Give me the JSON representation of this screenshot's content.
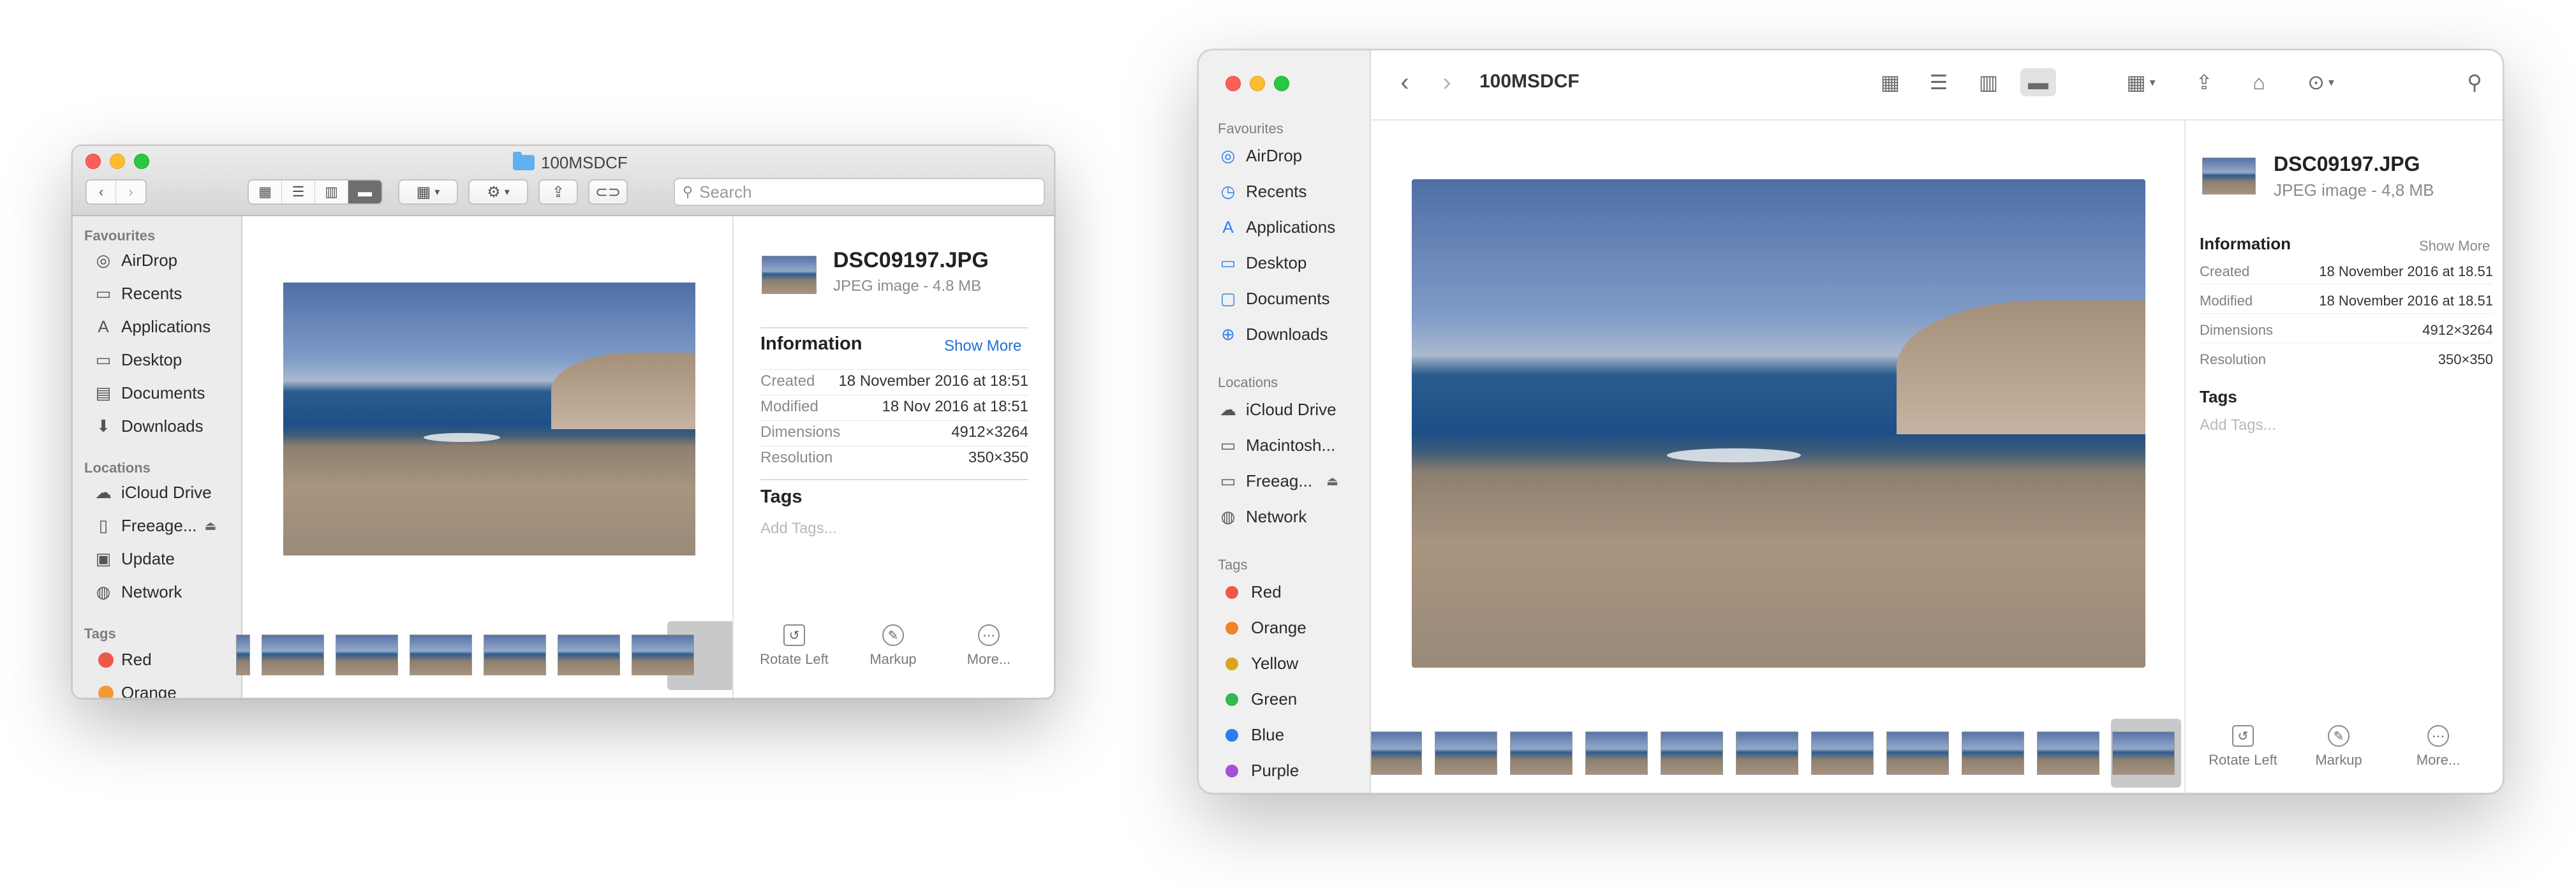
{
  "left_window": {
    "title": "100MSDCF",
    "search_placeholder": "Search",
    "sidebar": {
      "favourites_header": "Favourites",
      "favourites": [
        {
          "label": "AirDrop",
          "icon": "airdrop-icon"
        },
        {
          "label": "Recents",
          "icon": "clock-icon"
        },
        {
          "label": "Applications",
          "icon": "applications-icon"
        },
        {
          "label": "Desktop",
          "icon": "desktop-icon"
        },
        {
          "label": "Documents",
          "icon": "document-icon"
        },
        {
          "label": "Downloads",
          "icon": "download-icon"
        }
      ],
      "locations_header": "Locations",
      "locations": [
        {
          "label": "iCloud Drive",
          "icon": "cloud-icon"
        },
        {
          "label": "Freeage...",
          "icon": "drive-icon",
          "eject": "⏏"
        },
        {
          "label": "Update",
          "icon": "disk-icon"
        },
        {
          "label": "Network",
          "icon": "globe-icon"
        }
      ],
      "tags_header": "Tags",
      "tags": [
        {
          "label": "Red",
          "color": "#f0564a"
        },
        {
          "label": "Orange",
          "color": "#f39a38"
        }
      ]
    },
    "info": {
      "filename": "DSC09197.JPG",
      "filetype": "JPEG image - 4.8 MB",
      "information_header": "Information",
      "show_more": "Show More",
      "rows": [
        {
          "key": "Created",
          "value": "18 November 2016 at 18:51"
        },
        {
          "key": "Modified",
          "value": "18 Nov 2016 at 18:51"
        },
        {
          "key": "Dimensions",
          "value": "4912×3264"
        },
        {
          "key": "Resolution",
          "value": "350×350"
        }
      ],
      "tags_header": "Tags",
      "add_tags": "Add Tags...",
      "actions": [
        {
          "label": "Rotate Left",
          "icon": "rotate-left-icon"
        },
        {
          "label": "Markup",
          "icon": "markup-icon"
        },
        {
          "label": "More...",
          "icon": "more-icon"
        }
      ]
    }
  },
  "right_window": {
    "title": "100MSDCF",
    "sidebar": {
      "favourites_header": "Favourites",
      "favourites": [
        {
          "label": "AirDrop",
          "icon": "airdrop-icon"
        },
        {
          "label": "Recents",
          "icon": "clock-icon"
        },
        {
          "label": "Applications",
          "icon": "applications-icon"
        },
        {
          "label": "Desktop",
          "icon": "desktop-icon"
        },
        {
          "label": "Documents",
          "icon": "document-icon"
        },
        {
          "label": "Downloads",
          "icon": "download-icon"
        }
      ],
      "locations_header": "Locations",
      "locations": [
        {
          "label": "iCloud Drive",
          "icon": "cloud-icon"
        },
        {
          "label": "Macintosh...",
          "icon": "drive-icon"
        },
        {
          "label": "Freeag...",
          "icon": "drive-icon",
          "eject": "⏏"
        },
        {
          "label": "Network",
          "icon": "globe-icon"
        }
      ],
      "tags_header": "Tags",
      "tags": [
        {
          "label": "Red",
          "color": "#f0564a"
        },
        {
          "label": "Orange",
          "color": "#f0842a"
        },
        {
          "label": "Yellow",
          "color": "#d8a61c"
        },
        {
          "label": "Green",
          "color": "#33b94d"
        },
        {
          "label": "Blue",
          "color": "#2a7ff0"
        },
        {
          "label": "Purple",
          "color": "#a550d6"
        }
      ]
    },
    "info": {
      "filename": "DSC09197.JPG",
      "filetype": "JPEG image - 4,8 MB",
      "information_header": "Information",
      "show_more": "Show More",
      "rows": [
        {
          "key": "Created",
          "value": "18 November 2016 at 18.51"
        },
        {
          "key": "Modified",
          "value": "18 November 2016 at 18.51"
        },
        {
          "key": "Dimensions",
          "value": "4912×3264"
        },
        {
          "key": "Resolution",
          "value": "350×350"
        }
      ],
      "tags_header": "Tags",
      "add_tags": "Add Tags...",
      "actions": [
        {
          "label": "Rotate Left",
          "icon": "rotate-left-icon"
        },
        {
          "label": "Markup",
          "icon": "markup-icon"
        },
        {
          "label": "More...",
          "icon": "more-icon"
        }
      ]
    }
  }
}
